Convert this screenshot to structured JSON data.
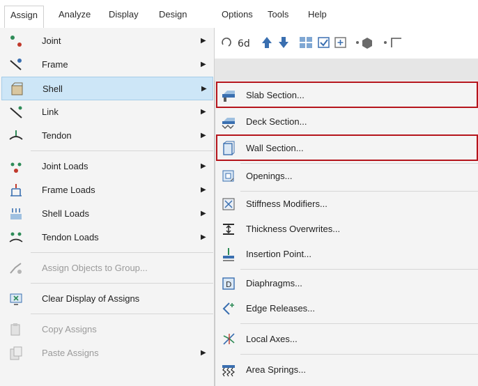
{
  "menubar": {
    "items": [
      "Assign",
      "Analyze",
      "Display",
      "Design",
      "Options",
      "Tools",
      "Help"
    ]
  },
  "assign_menu": {
    "items": [
      {
        "label": "Joint",
        "icon": "joint-icon",
        "submenu": true
      },
      {
        "label": "Frame",
        "icon": "frame-icon",
        "submenu": true
      },
      {
        "label": "Shell",
        "icon": "shell-icon",
        "submenu": true,
        "highlighted": true
      },
      {
        "label": "Link",
        "icon": "link-icon",
        "submenu": true
      },
      {
        "label": "Tendon",
        "icon": "tendon-icon",
        "submenu": true
      },
      {
        "label": "Joint Loads",
        "icon": "joint-loads-icon",
        "submenu": true
      },
      {
        "label": "Frame Loads",
        "icon": "frame-loads-icon",
        "submenu": true
      },
      {
        "label": "Shell Loads",
        "icon": "shell-loads-icon",
        "submenu": true
      },
      {
        "label": "Tendon Loads",
        "icon": "tendon-loads-icon",
        "submenu": true
      },
      {
        "label": "Assign Objects to Group...",
        "icon": "group-icon",
        "submenu": false,
        "disabled": true
      },
      {
        "label": "Clear Display of Assigns",
        "icon": "clear-display-icon",
        "submenu": false
      },
      {
        "label": "Copy Assigns",
        "icon": "copy-icon",
        "submenu": false,
        "disabled": true
      },
      {
        "label": "Paste Assigns",
        "icon": "paste-icon",
        "submenu": true,
        "disabled": true
      }
    ]
  },
  "shell_submenu": {
    "items": [
      {
        "label": "Slab Section...",
        "icon": "slab-section-icon",
        "boxed": true
      },
      {
        "label": "Deck Section...",
        "icon": "deck-section-icon"
      },
      {
        "label": "Wall Section...",
        "icon": "wall-section-icon",
        "boxed": true
      },
      {
        "label": "Openings...",
        "icon": "openings-icon"
      },
      {
        "label": "Stiffness Modifiers...",
        "icon": "stiffness-modifiers-icon"
      },
      {
        "label": "Thickness Overwrites...",
        "icon": "thickness-overwrites-icon"
      },
      {
        "label": "Insertion Point...",
        "icon": "insertion-point-icon"
      },
      {
        "label": "Diaphragms...",
        "icon": "diaphragms-icon"
      },
      {
        "label": "Edge Releases...",
        "icon": "edge-releases-icon"
      },
      {
        "label": "Local Axes...",
        "icon": "local-axes-icon"
      },
      {
        "label": "Area Springs...",
        "icon": "area-springs-icon"
      }
    ]
  },
  "colors": {
    "highlight": "#cde6f7",
    "callout": "#b5141b",
    "menu_bg": "#f4f4f4"
  }
}
